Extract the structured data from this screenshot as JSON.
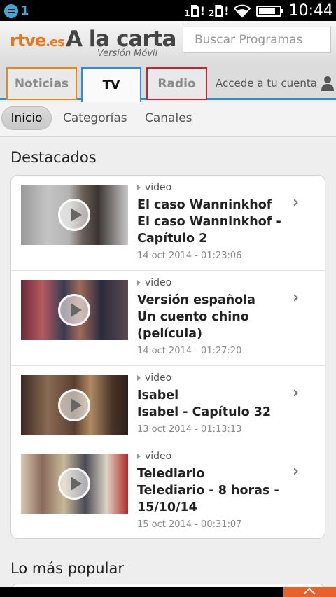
{
  "status_bar": {
    "notification_count": "1",
    "sim1_label": "1",
    "sim2_label": "2",
    "sim_alert": "!",
    "time": "10:44"
  },
  "header": {
    "logo_brand": "rtve",
    "logo_domain": ".es",
    "logo_title": "A la carta",
    "logo_subtitle": "Versión Móvil",
    "search_placeholder": "Buscar Programas"
  },
  "main_tabs": {
    "noticias": "Noticias",
    "tv": "TV",
    "radio": "Radio",
    "account": "Accede a tu cuenta"
  },
  "sub_tabs": {
    "inicio": "Inicio",
    "categorias": "Categorías",
    "canales": "Canales"
  },
  "sections": {
    "featured_title": "Destacados",
    "popular_title": "Lo más popular"
  },
  "featured_items": [
    {
      "type": "video",
      "title_line1": "El caso Wanninkhof",
      "title_line2": "El caso Wanninkhof -",
      "title_line3": "Capítulo 2",
      "date": "14 oct 2014 - 01:23:06"
    },
    {
      "type": "video",
      "title_line1": "Versión española",
      "title_line2": "Un cuento chino",
      "title_line3": "(película)",
      "date": "14 oct 2014 - 01:27:20"
    },
    {
      "type": "video",
      "title_line1": "Isabel",
      "title_line2": "Isabel - Capítulo 32",
      "title_line3": "",
      "date": "13 oct 2014 - 01:13:13"
    },
    {
      "type": "video",
      "title_line1": "Telediario",
      "title_line2": "Telediario - 8 horas -",
      "title_line3": "15/10/14",
      "date": "15 oct 2014 - 00:31:07"
    }
  ],
  "colors": {
    "noticias_accent": "#e58a1a",
    "tv_accent": "#2a8fd6",
    "radio_accent": "#cc2233",
    "brand_orange": "#e8771c",
    "scroll_top_button": "#e8602a"
  }
}
